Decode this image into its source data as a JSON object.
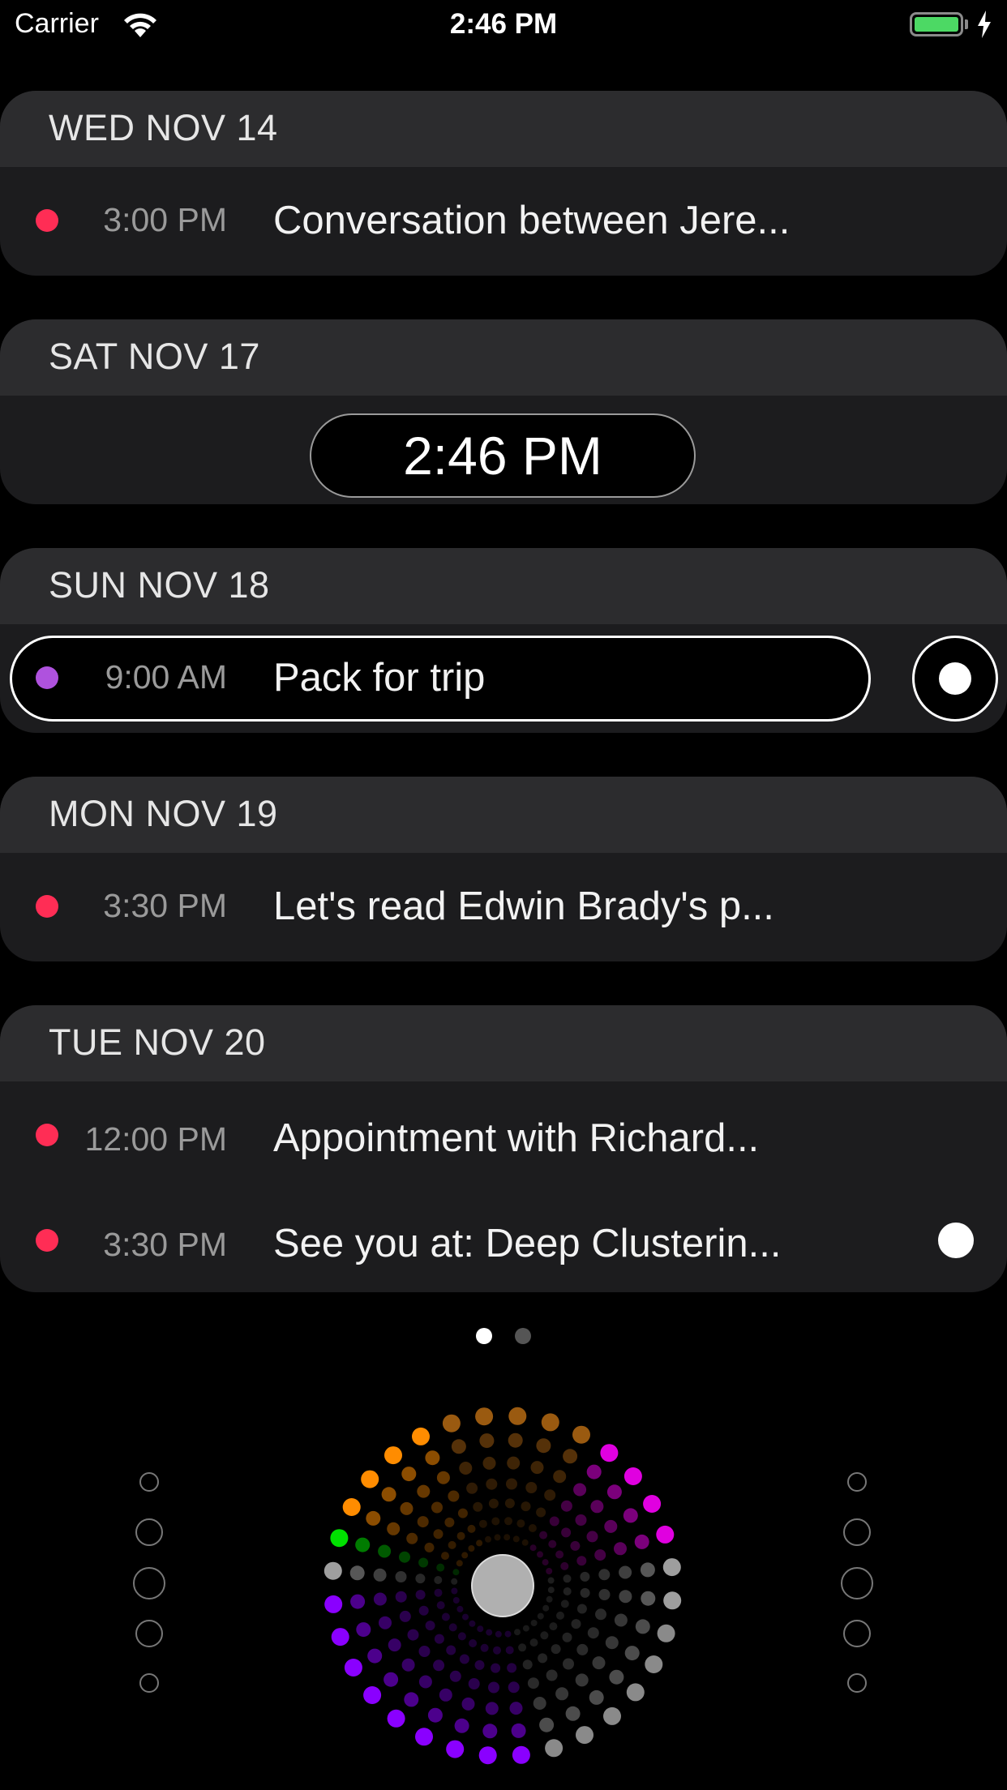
{
  "status_bar": {
    "carrier": "Carrier",
    "time": "2:46 PM",
    "battery_color": "#4cd964"
  },
  "days": [
    {
      "header": "WED NOV 14",
      "events": [
        {
          "time": "3:00 PM",
          "title": "Conversation between Jere...",
          "dot_color": "#ff2d55"
        }
      ]
    },
    {
      "header": "SAT NOV 17",
      "now_indicator": "2:46 PM"
    },
    {
      "header": "SUN NOV 18",
      "events": [
        {
          "time": "9:00 AM",
          "title": "Pack for trip",
          "dot_color": "#af52de",
          "selected": true
        }
      ]
    },
    {
      "header": "MON NOV 19",
      "events": [
        {
          "time": "3:30 PM",
          "title": "Let's read Edwin Brady's p...",
          "dot_color": "#ff2d55"
        }
      ]
    },
    {
      "header": "TUE NOV 20",
      "events": [
        {
          "time": "12:00 PM",
          "title": "Appointment with Richard...",
          "dot_color": "#ff2d55"
        },
        {
          "time": "3:30 PM",
          "title": "See you at: Deep Clusterin...",
          "dot_color": "#ff2d55"
        }
      ]
    }
  ],
  "page_control": {
    "count": 2,
    "current": 1
  },
  "color_wheel_palette": {
    "orange": "#ff8c00",
    "magenta": "#e000e0",
    "green": "#00e000",
    "purple": "#8a00ff",
    "gray": "#9e9e9e"
  }
}
